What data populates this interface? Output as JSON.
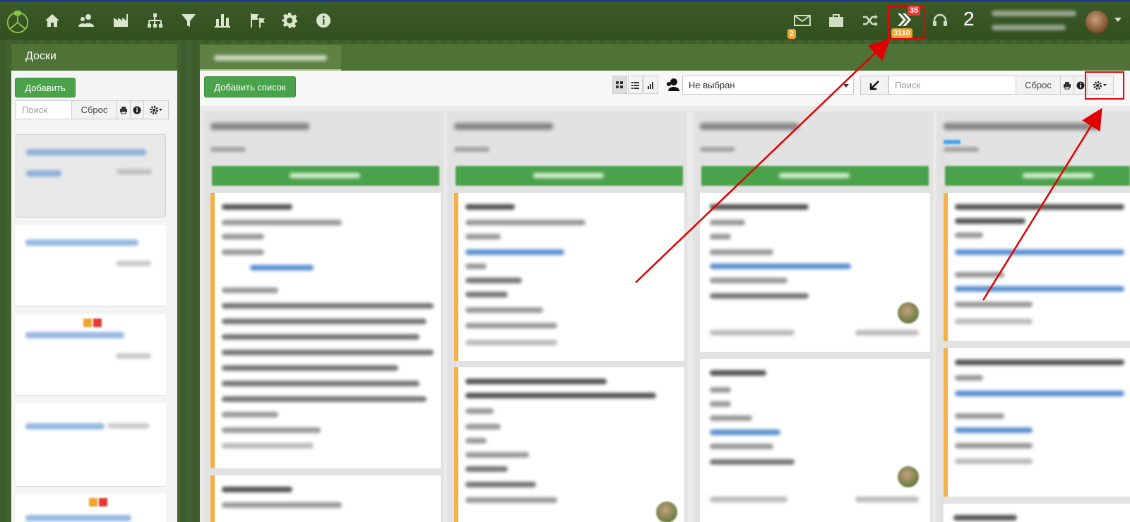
{
  "topbar": {
    "nav_icons": [
      "home-icon",
      "users-icon",
      "factory-icon",
      "org-chart-icon",
      "filter-icon",
      "bar-chart-icon",
      "flags-icon",
      "gear-icon",
      "info-icon"
    ],
    "mail_badge": "2",
    "tasks_badge_top": "35",
    "tasks_badge_bottom": "3110",
    "online_count": "2"
  },
  "left_panel": {
    "title": "Доски",
    "add_label": "Добавить",
    "search_placeholder": "Поиск",
    "reset_label": "Сброс"
  },
  "main_panel": {
    "add_list_label": "Добавить список",
    "assignee_select": "Не выбран",
    "search_placeholder": "Поиск",
    "reset_label": "Сброс"
  },
  "colors": {
    "topbar": "#3b5a28",
    "accent_green": "#4aa34a",
    "card_stripe": "#f5b04a",
    "badge_red": "#e53935",
    "badge_orange": "#f0a22e",
    "annotation_red": "#e00000"
  }
}
